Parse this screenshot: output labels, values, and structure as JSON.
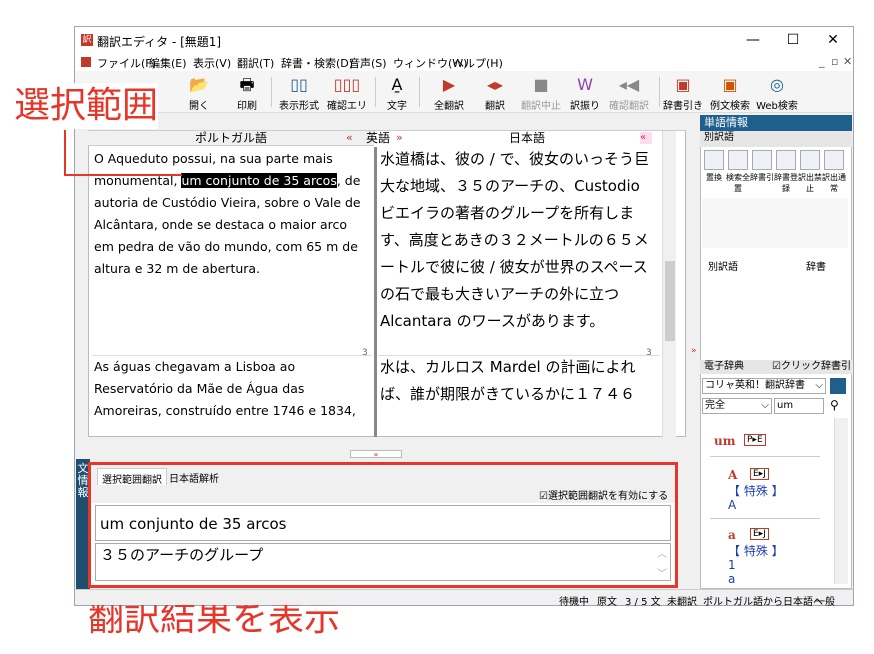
{
  "window": {
    "title": "翻訳エディタ - [無題1]",
    "minimize": "—",
    "maximize": "☐",
    "close": "✕"
  },
  "menu": [
    "ファイル(F)",
    "編集(E)",
    "表示(V)",
    "翻訳(T)",
    "辞書・検索(D)",
    "音声(S)",
    "ウィンドウ(W)",
    "ヘルプ(H)"
  ],
  "toolbar": {
    "open": "開く",
    "print": "印刷",
    "display_format": "表示形式",
    "confirm_area": "確認エリア",
    "font": "文字",
    "translate_all": "全翻訳",
    "translate": "翻訳",
    "stop": "翻訳中止",
    "alt_trans": "訳振り",
    "confirm_trans": "確認翻訳",
    "dict_lookup": "辞書引き",
    "example_search": "例文検索",
    "web_search": "Web検索"
  },
  "callouts": {
    "selection": "選択範囲",
    "show_result": "翻訳結果を表示"
  },
  "editor": {
    "source_lang": "ポルトガル語",
    "swap_lang": "英語",
    "target_lang": "日本語",
    "sent1_pre": "O Aqueduto possui, na sua parte mais monumental, ",
    "sent1_sel": "um conjunto de 35 arcos",
    "sent1_post": ", de autoria de Custódio Vieira, sobre o Vale de Alcântara, onde se destaca o maior arco em pedra de vão do mundo, com 65 m de altura e 32 m de abertura.",
    "trans1": "水道橋は、彼の / で、彼女のいっそう巨大な地域、３５のアーチの、Custodio ビエイラの著者のグループを所有します、高度とあきの３２メートルの６５メートルで彼に彼 / 彼女が世界のスペースの石で最も大きいアーチの外に立つ Alcantara のワースがあります。",
    "num1": "3",
    "num2": "3",
    "sent2": "As águas chegavam a Lisboa ao Reservatório da Mãe de Água das Amoreiras, construído entre 1746 e 1834,",
    "trans2": "水は、カルロス Mardel の計画によれば、誰が期限がきているかに１７４６"
  },
  "bottom": {
    "side_label": "文情報",
    "tab1": "選択範囲翻訳",
    "tab2": "日本語解析",
    "checkbox_label": "選択範囲翻訳を有効にする",
    "source": "um conjunto de 35 arcos",
    "result": "３５のアーチのグループ"
  },
  "right": {
    "title": "単語情報",
    "alt_words": "別訳語",
    "buttons": [
      "置換",
      "検索全置",
      "辞書引",
      "辞書登録",
      "訳出禁止",
      "訳出通常"
    ],
    "col1": "別訳語",
    "col2": "辞書",
    "edict": "電子辞典",
    "click_lookup": "クリック辞書引",
    "dict_name": "コリャ英和！翻訳辞書",
    "match": "完全",
    "query": "um",
    "entries": [
      {
        "head": "um",
        "tag": "P▸E"
      },
      {
        "head": "A",
        "tag": "E▸J",
        "cat": "【 特殊 】",
        "val": "A"
      },
      {
        "head": "a",
        "tag": "E▸J",
        "cat": "【 特殊 】",
        "val": "1",
        "val2": "a"
      }
    ]
  },
  "status": {
    "state": "待機中",
    "mode": "原文",
    "count": "3 / 5 文",
    "trans_state": "未翻訳",
    "direction": "ポルトガル語から日本語へ",
    "general": "一般"
  },
  "colors": {
    "accent": "#e8352a",
    "header": "#1f5f8b"
  }
}
